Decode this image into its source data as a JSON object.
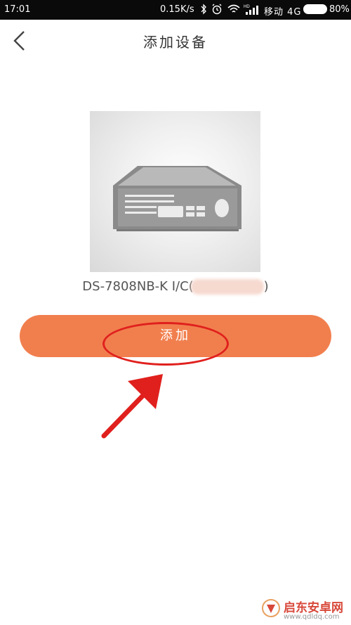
{
  "status_bar": {
    "time": "17:01",
    "network_speed": "0.15K/s",
    "carrier": "移动 4G",
    "battery_percent": "80%"
  },
  "header": {
    "title": "添加设备"
  },
  "device": {
    "name": "DS-7808NB-K I/C(",
    "name_suffix": ")"
  },
  "actions": {
    "add_label": "添加"
  },
  "watermark": {
    "text": "启东安卓网",
    "url": "www.qdldq.com"
  },
  "colors": {
    "accent": "#f17f4e",
    "annotation": "#e0201d"
  }
}
